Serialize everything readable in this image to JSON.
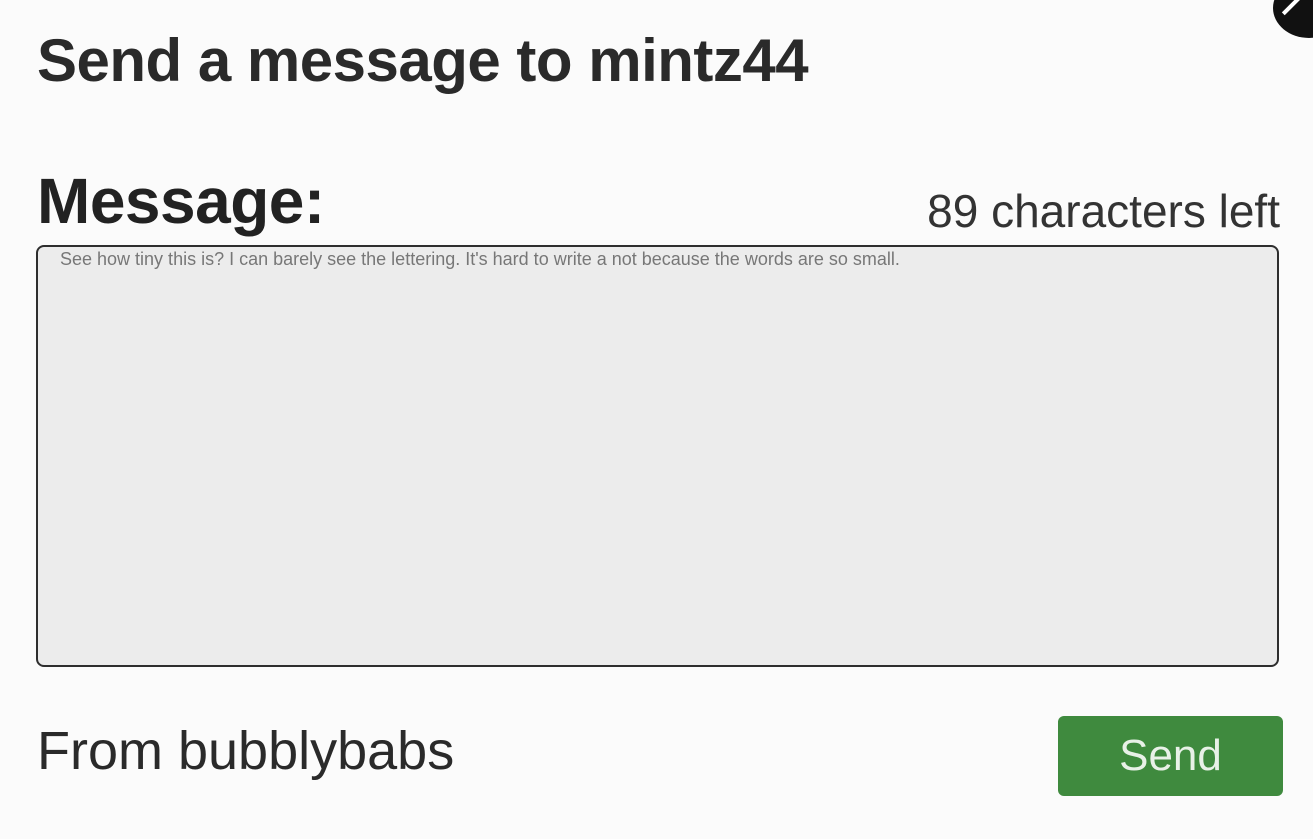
{
  "dialog": {
    "title": "Send a message to mintz44"
  },
  "message": {
    "label": "Message:",
    "counter": "89 characters left",
    "value": "See how tiny this is?  I can barely see the lettering. It's hard to write a not because the words are so small."
  },
  "footer": {
    "from_text": "From bubblybabs",
    "send_label": "Send"
  },
  "colors": {
    "send_button": "#3f8a3e",
    "textarea_bg": "#ececec",
    "page_bg": "#fbfbfb"
  }
}
